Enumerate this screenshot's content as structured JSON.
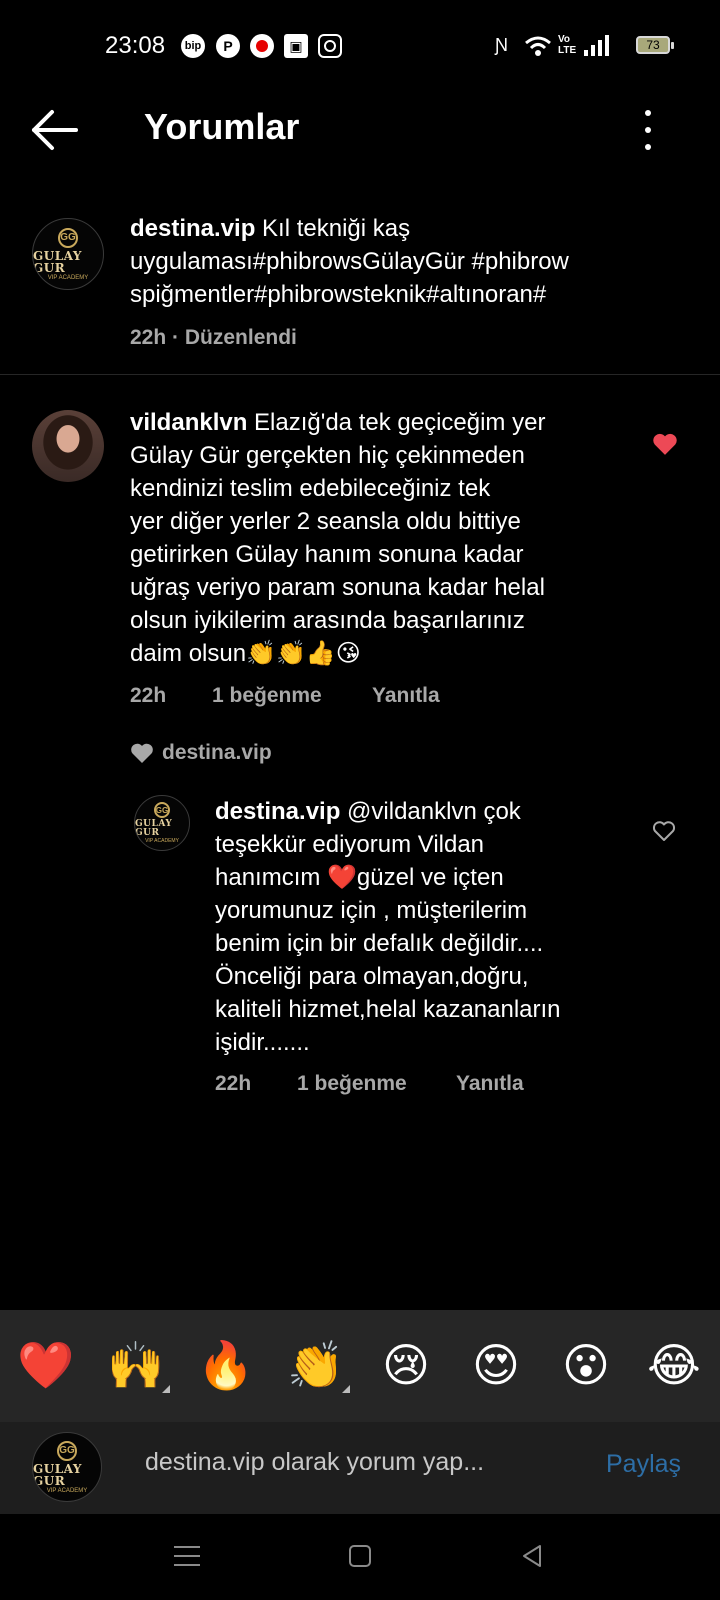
{
  "status_bar": {
    "time": "23:08",
    "left_icons": [
      "bip-icon",
      "pinterest-icon",
      "vodafone-icon",
      "box-icon",
      "instagram-icon"
    ],
    "right_icons": [
      "nfc-icon",
      "wifi-icon",
      "volte-icon",
      "signal-icon"
    ],
    "volte": "Vo LTE",
    "battery": "73"
  },
  "header": {
    "title": "Yorumlar"
  },
  "caption": {
    "username": "destina.vip",
    "text_line1": " Kıl tekniği kaş",
    "text_line2": "uygulaması#phibrowsGülayGür #phibrow",
    "text_line3": "spiğmentler#phibrowsteknik#altınoran#",
    "time": "22h",
    "separator": "·",
    "edited": "Düzenlendi"
  },
  "avatar_logo": {
    "brand": "GULAY GUR",
    "sub": "VIP ACADEMY",
    "mono": "GG"
  },
  "comment": {
    "username": "vildanklvn",
    "lines": [
      " Elazığ'da tek geçiceğim yer",
      "Gülay Gür gerçekten hiç çekinmeden",
      "kendinizi teslim edebileceğiniz tek",
      "yer diğer yerler 2 seansla oldu bittiye",
      "getirirken Gülay hanım sonuna kadar",
      "uğraş veriyo param sonuna kadar helal",
      "olsun iyikilerim  arasında başarılarınız",
      "daim olsun👏👏👍😘"
    ],
    "time": "22h",
    "likes": "1 beğenme",
    "reply": "Yanıtla",
    "liked_by_author": "destina.vip",
    "like_color": "#ed4956"
  },
  "reply": {
    "username": "destina.vip",
    "lines": [
      " @vildanklvn çok",
      "teşekkür ediyorum Vildan",
      "hanımcım ❤️güzel ve içten",
      "yorumunuz için , müşterilerim",
      "benim için bir defalık değildir....",
      "Önceliği para olmayan,doğru,",
      "kaliteli hizmet,helal kazananların",
      "işidir......."
    ],
    "time": "22h",
    "likes": "1 beğenme",
    "reply": "Yanıtla"
  },
  "emoji_bar": [
    "❤️",
    "🙌",
    "🔥",
    "👏",
    "😢",
    "😍",
    "😮",
    "😂"
  ],
  "composer": {
    "placeholder": "destina.vip olarak yorum yap...",
    "share": "Paylaş",
    "share_color": "#2d6ea6"
  },
  "nav": [
    "menu-icon",
    "home-square-icon",
    "back-triangle-icon"
  ]
}
